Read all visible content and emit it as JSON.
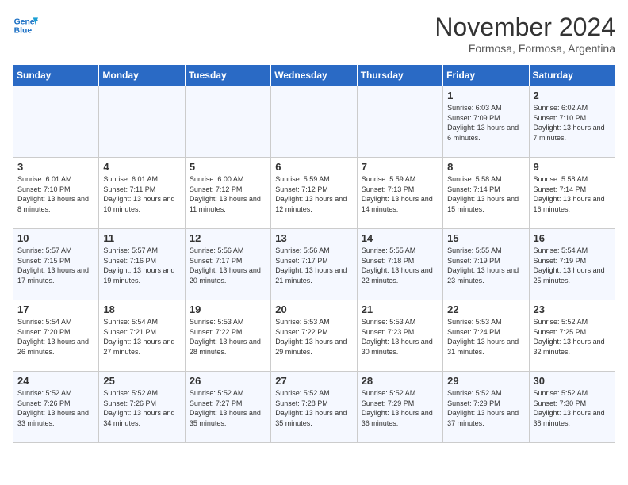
{
  "header": {
    "logo_line1": "General",
    "logo_line2": "Blue",
    "month": "November 2024",
    "location": "Formosa, Formosa, Argentina"
  },
  "days_of_week": [
    "Sunday",
    "Monday",
    "Tuesday",
    "Wednesday",
    "Thursday",
    "Friday",
    "Saturday"
  ],
  "weeks": [
    [
      {
        "num": "",
        "info": ""
      },
      {
        "num": "",
        "info": ""
      },
      {
        "num": "",
        "info": ""
      },
      {
        "num": "",
        "info": ""
      },
      {
        "num": "",
        "info": ""
      },
      {
        "num": "1",
        "info": "Sunrise: 6:03 AM\nSunset: 7:09 PM\nDaylight: 13 hours and 6 minutes."
      },
      {
        "num": "2",
        "info": "Sunrise: 6:02 AM\nSunset: 7:10 PM\nDaylight: 13 hours and 7 minutes."
      }
    ],
    [
      {
        "num": "3",
        "info": "Sunrise: 6:01 AM\nSunset: 7:10 PM\nDaylight: 13 hours and 8 minutes."
      },
      {
        "num": "4",
        "info": "Sunrise: 6:01 AM\nSunset: 7:11 PM\nDaylight: 13 hours and 10 minutes."
      },
      {
        "num": "5",
        "info": "Sunrise: 6:00 AM\nSunset: 7:12 PM\nDaylight: 13 hours and 11 minutes."
      },
      {
        "num": "6",
        "info": "Sunrise: 5:59 AM\nSunset: 7:12 PM\nDaylight: 13 hours and 12 minutes."
      },
      {
        "num": "7",
        "info": "Sunrise: 5:59 AM\nSunset: 7:13 PM\nDaylight: 13 hours and 14 minutes."
      },
      {
        "num": "8",
        "info": "Sunrise: 5:58 AM\nSunset: 7:14 PM\nDaylight: 13 hours and 15 minutes."
      },
      {
        "num": "9",
        "info": "Sunrise: 5:58 AM\nSunset: 7:14 PM\nDaylight: 13 hours and 16 minutes."
      }
    ],
    [
      {
        "num": "10",
        "info": "Sunrise: 5:57 AM\nSunset: 7:15 PM\nDaylight: 13 hours and 17 minutes."
      },
      {
        "num": "11",
        "info": "Sunrise: 5:57 AM\nSunset: 7:16 PM\nDaylight: 13 hours and 19 minutes."
      },
      {
        "num": "12",
        "info": "Sunrise: 5:56 AM\nSunset: 7:17 PM\nDaylight: 13 hours and 20 minutes."
      },
      {
        "num": "13",
        "info": "Sunrise: 5:56 AM\nSunset: 7:17 PM\nDaylight: 13 hours and 21 minutes."
      },
      {
        "num": "14",
        "info": "Sunrise: 5:55 AM\nSunset: 7:18 PM\nDaylight: 13 hours and 22 minutes."
      },
      {
        "num": "15",
        "info": "Sunrise: 5:55 AM\nSunset: 7:19 PM\nDaylight: 13 hours and 23 minutes."
      },
      {
        "num": "16",
        "info": "Sunrise: 5:54 AM\nSunset: 7:19 PM\nDaylight: 13 hours and 25 minutes."
      }
    ],
    [
      {
        "num": "17",
        "info": "Sunrise: 5:54 AM\nSunset: 7:20 PM\nDaylight: 13 hours and 26 minutes."
      },
      {
        "num": "18",
        "info": "Sunrise: 5:54 AM\nSunset: 7:21 PM\nDaylight: 13 hours and 27 minutes."
      },
      {
        "num": "19",
        "info": "Sunrise: 5:53 AM\nSunset: 7:22 PM\nDaylight: 13 hours and 28 minutes."
      },
      {
        "num": "20",
        "info": "Sunrise: 5:53 AM\nSunset: 7:22 PM\nDaylight: 13 hours and 29 minutes."
      },
      {
        "num": "21",
        "info": "Sunrise: 5:53 AM\nSunset: 7:23 PM\nDaylight: 13 hours and 30 minutes."
      },
      {
        "num": "22",
        "info": "Sunrise: 5:53 AM\nSunset: 7:24 PM\nDaylight: 13 hours and 31 minutes."
      },
      {
        "num": "23",
        "info": "Sunrise: 5:52 AM\nSunset: 7:25 PM\nDaylight: 13 hours and 32 minutes."
      }
    ],
    [
      {
        "num": "24",
        "info": "Sunrise: 5:52 AM\nSunset: 7:26 PM\nDaylight: 13 hours and 33 minutes."
      },
      {
        "num": "25",
        "info": "Sunrise: 5:52 AM\nSunset: 7:26 PM\nDaylight: 13 hours and 34 minutes."
      },
      {
        "num": "26",
        "info": "Sunrise: 5:52 AM\nSunset: 7:27 PM\nDaylight: 13 hours and 35 minutes."
      },
      {
        "num": "27",
        "info": "Sunrise: 5:52 AM\nSunset: 7:28 PM\nDaylight: 13 hours and 35 minutes."
      },
      {
        "num": "28",
        "info": "Sunrise: 5:52 AM\nSunset: 7:29 PM\nDaylight: 13 hours and 36 minutes."
      },
      {
        "num": "29",
        "info": "Sunrise: 5:52 AM\nSunset: 7:29 PM\nDaylight: 13 hours and 37 minutes."
      },
      {
        "num": "30",
        "info": "Sunrise: 5:52 AM\nSunset: 7:30 PM\nDaylight: 13 hours and 38 minutes."
      }
    ]
  ]
}
